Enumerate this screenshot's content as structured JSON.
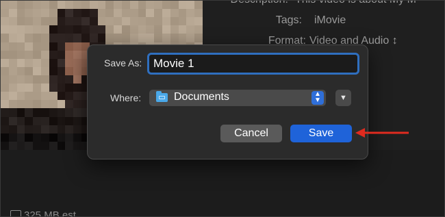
{
  "background_window": {
    "description_label": "Description:",
    "description_value": "This video is about My M",
    "tags_label": "Tags:",
    "tags_value": "iMovie",
    "format_label": "Format:",
    "format_value": "Video and Audio ↕",
    "size_text": "325 MB est."
  },
  "dialog": {
    "save_as_label": "Save As:",
    "save_as_value": "Movie 1",
    "where_label": "Where:",
    "where_value": "Documents",
    "cancel_label": "Cancel",
    "save_label": "Save"
  },
  "icons": {
    "folder": "folder-icon",
    "stepper": "up-down-chevron-icon",
    "expand": "chevron-down-icon",
    "annotation": "red-arrow-icon"
  },
  "colors": {
    "accent": "#1f63d9",
    "focus_ring": "#2f6fbf",
    "folder": "#4aa8e8",
    "annotation_arrow": "#e02b1f"
  }
}
